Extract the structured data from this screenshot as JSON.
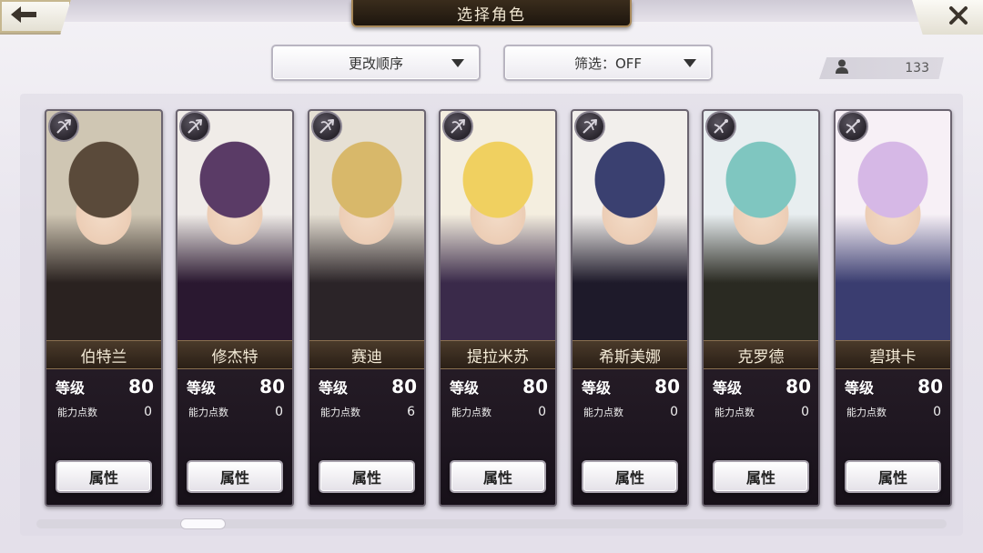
{
  "header": {
    "title": "选择角色",
    "back_icon": "arrow-left-icon",
    "close_icon": "close-icon"
  },
  "controls": {
    "order_label": "更改顺序",
    "filter_label": "筛选：OFF",
    "count": "133"
  },
  "colors": {
    "title_plate": "#2a1f14",
    "name_plate": "#3a2c1e",
    "card_bg": "#1b1520"
  },
  "cards": [
    {
      "name": "伯特兰",
      "level_label": "等级",
      "level": "80",
      "ap_label": "能力点数",
      "ap": "0",
      "attr_label": "属性",
      "class_icon": "bow-icon",
      "palette": [
        "#cfc6b3",
        "#5a4a3a",
        "#2a2220"
      ]
    },
    {
      "name": "修杰特",
      "level_label": "等级",
      "level": "80",
      "ap_label": "能力点数",
      "ap": "0",
      "attr_label": "属性",
      "class_icon": "bow-icon",
      "palette": [
        "#f0ece8",
        "#5a3b66",
        "#2a1830"
      ]
    },
    {
      "name": "赛迪",
      "level_label": "等级",
      "level": "80",
      "ap_label": "能力点数",
      "ap": "6",
      "attr_label": "属性",
      "class_icon": "bow-icon",
      "palette": [
        "#e6e0d4",
        "#d8b86a",
        "#2b2428"
      ]
    },
    {
      "name": "提拉米苏",
      "level_label": "等级",
      "level": "80",
      "ap_label": "能力点数",
      "ap": "0",
      "attr_label": "属性",
      "class_icon": "bow-icon",
      "palette": [
        "#f4eedf",
        "#f0d060",
        "#3a2a4a"
      ]
    },
    {
      "name": "希斯美娜",
      "level_label": "等级",
      "level": "80",
      "ap_label": "能力点数",
      "ap": "0",
      "attr_label": "属性",
      "class_icon": "bow-icon",
      "palette": [
        "#f2efec",
        "#3a4070",
        "#1e1a2a"
      ]
    },
    {
      "name": "克罗德",
      "level_label": "等级",
      "level": "80",
      "ap_label": "能力点数",
      "ap": "0",
      "attr_label": "属性",
      "class_icon": "crossbow-icon",
      "palette": [
        "#e8eef0",
        "#7fc6c0",
        "#2a2a22"
      ]
    },
    {
      "name": "碧琪卡",
      "level_label": "等级",
      "level": "80",
      "ap_label": "能力点数",
      "ap": "0",
      "attr_label": "属性",
      "class_icon": "crossbow-icon",
      "palette": [
        "#f7f0f6",
        "#d6b8e6",
        "#3a3d70"
      ]
    }
  ]
}
